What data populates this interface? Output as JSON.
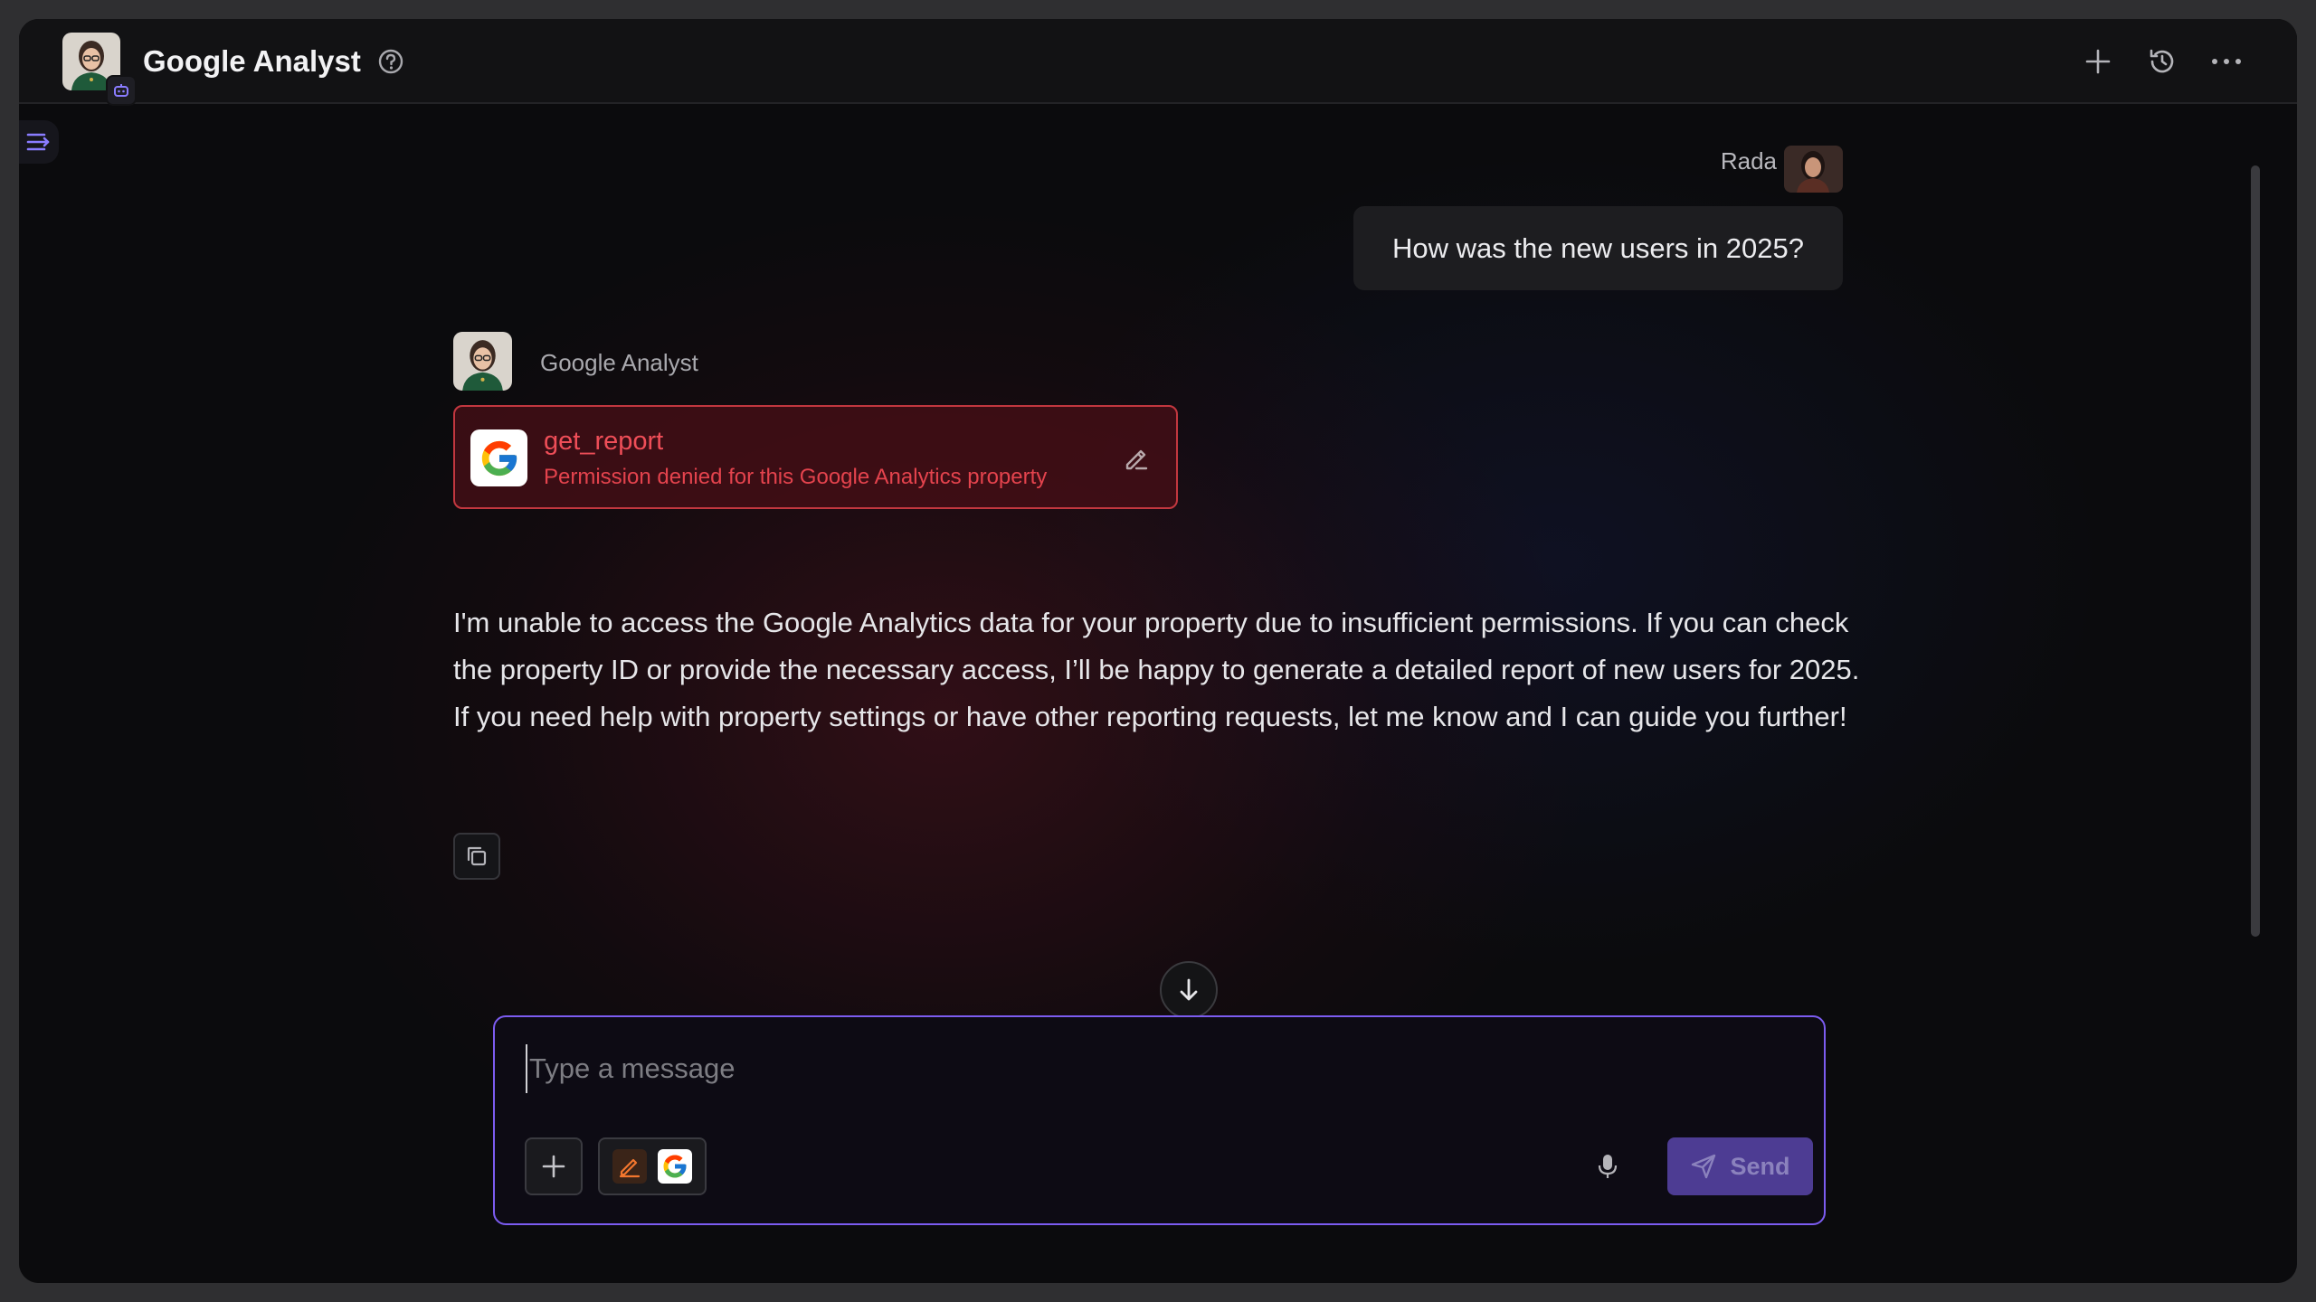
{
  "header": {
    "title": "Google Analyst",
    "icons": [
      "help-icon",
      "plus-icon",
      "history-icon",
      "more-icon"
    ]
  },
  "conversation": {
    "user": {
      "name": "Rada",
      "message": "How was the new users in 2025?"
    },
    "agent": {
      "name": "Google Analyst",
      "tool_call": {
        "name": "get_report",
        "status": "Permission denied for this Google Analytics property",
        "status_color": "#e4434d"
      },
      "paragraphs": [
        "I'm unable to access the Google Analytics data for your property due to insufficient permissions. If you can check the property ID or provide the necessary access, I’ll be happy to generate a detailed report of new users for 2025.",
        "If you need help with property settings or have other reporting requests, let me know and I can guide you further!"
      ]
    }
  },
  "composer": {
    "placeholder": "Type a message",
    "value": "",
    "send_label": "Send"
  },
  "colors": {
    "accent": "#7c5cf0",
    "send_button": "#4d3c93",
    "error": "#c2373f"
  }
}
